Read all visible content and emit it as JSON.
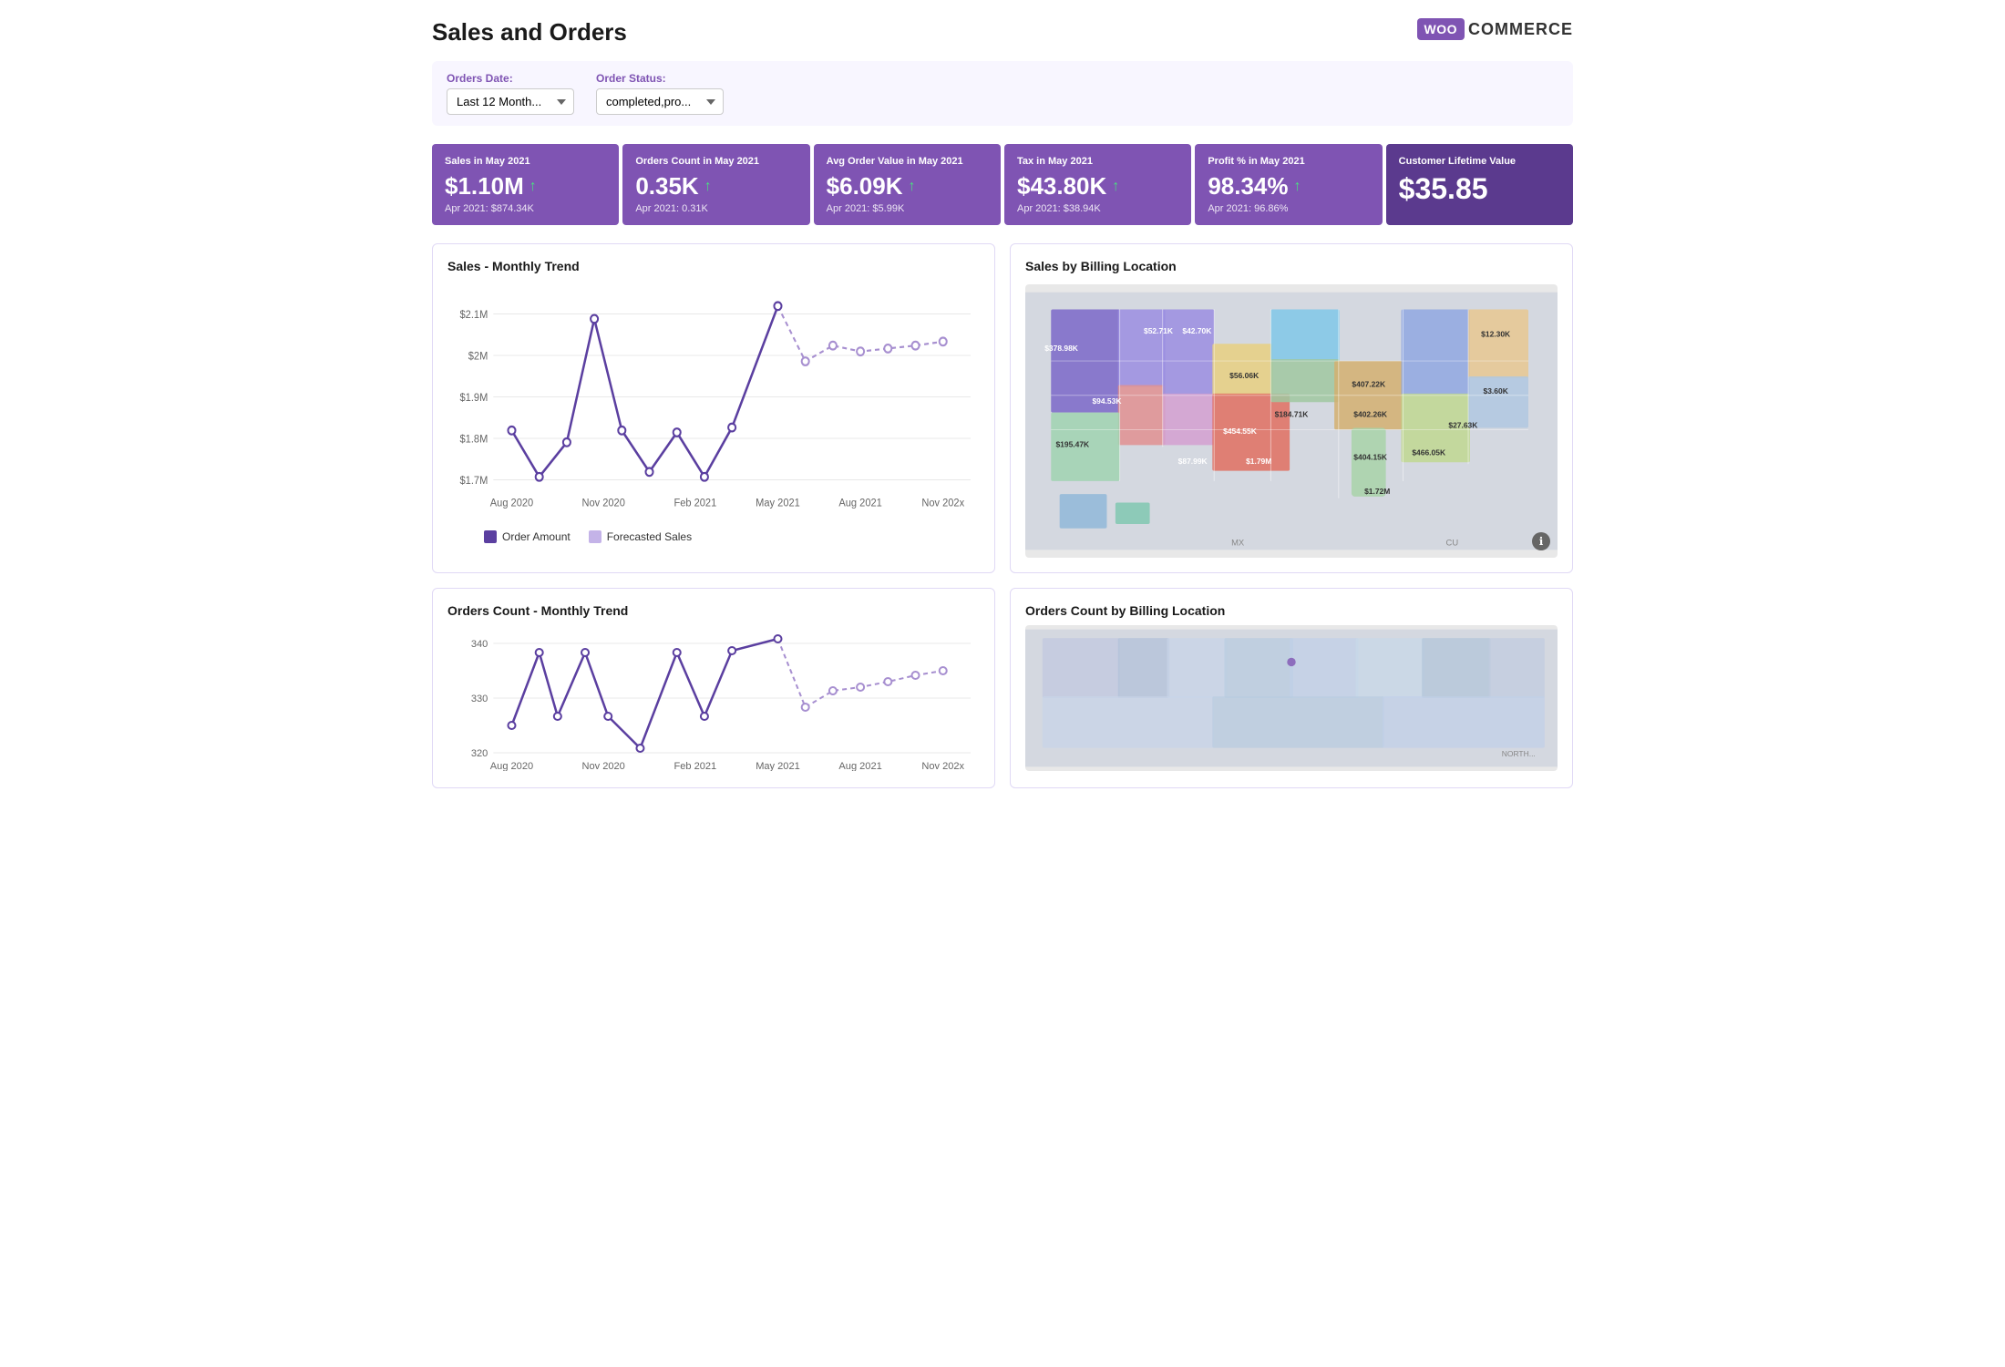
{
  "header": {
    "title": "Sales and Orders",
    "logo_woo": "WOO",
    "logo_commerce": "COMMERCE"
  },
  "filters": {
    "date_label": "Orders Date:",
    "date_value": "Last 12 Month...",
    "status_label": "Order Status:",
    "status_value": "completed,pro..."
  },
  "kpi_cards": [
    {
      "title": "Sales in May 2021",
      "value": "$1.10M",
      "arrow": "↑",
      "prev": "Apr 2021: $874.34K"
    },
    {
      "title": "Orders Count in May 2021",
      "value": "0.35K",
      "arrow": "↑",
      "prev": "Apr 2021: 0.31K"
    },
    {
      "title": "Avg Order Value in May 2021",
      "value": "$6.09K",
      "arrow": "↑",
      "prev": "Apr 2021: $5.99K"
    },
    {
      "title": "Tax in May 2021",
      "value": "$43.80K",
      "arrow": "↑",
      "prev": "Apr 2021: $38.94K"
    },
    {
      "title": "Profit % in May 2021",
      "value": "98.34%",
      "arrow": "↑",
      "prev": "Apr 2021: 96.86%"
    },
    {
      "title": "Customer Lifetime Value",
      "value": "$35.85",
      "arrow": "",
      "prev": ""
    }
  ],
  "sales_trend_chart": {
    "title": "Sales - Monthly Trend",
    "y_labels": [
      "$2.1M",
      "$2M",
      "$1.9M",
      "$1.8M",
      "$1.7M"
    ],
    "x_labels": [
      "Aug 2020",
      "Nov 2020",
      "Feb 2021",
      "May 2021",
      "Aug 2021",
      "Nov 202x"
    ],
    "legend": {
      "order_amount": "Order Amount",
      "forecasted_sales": "Forecasted Sales"
    }
  },
  "billing_location_chart": {
    "title": "Sales by Billing Location",
    "map_labels": [
      {
        "text": "$378.98K",
        "left": "21%",
        "top": "30%"
      },
      {
        "text": "$52.71K",
        "left": "33%",
        "top": "28%"
      },
      {
        "text": "$42.70K",
        "left": "43%",
        "top": "25%"
      },
      {
        "text": "$94.53K",
        "left": "25%",
        "top": "38%"
      },
      {
        "text": "$56.06K",
        "left": "42%",
        "top": "35%"
      },
      {
        "text": "$407.22K",
        "left": "57%",
        "top": "33%"
      },
      {
        "text": "$12.30K",
        "left": "78%",
        "top": "28%"
      },
      {
        "text": "$184.71K",
        "left": "46%",
        "top": "43%"
      },
      {
        "text": "$195.47K",
        "left": "16%",
        "top": "52%"
      },
      {
        "text": "$454.55K",
        "left": "35%",
        "top": "54%"
      },
      {
        "text": "$402.26K",
        "left": "55%",
        "top": "48%"
      },
      {
        "text": "$3.60K",
        "left": "82%",
        "top": "38%"
      },
      {
        "text": "$27.63K",
        "left": "73%",
        "top": "46%"
      },
      {
        "text": "$87.99K",
        "left": "30%",
        "top": "64%"
      },
      {
        "text": "$1.79M",
        "left": "42%",
        "top": "68%"
      },
      {
        "text": "$404.15K",
        "left": "55%",
        "top": "62%"
      },
      {
        "text": "$466.05K",
        "left": "68%",
        "top": "58%"
      },
      {
        "text": "$1.72M",
        "left": "60%",
        "top": "75%"
      }
    ]
  },
  "orders_count_chart": {
    "title": "Orders Count - Monthly Trend",
    "y_labels": [
      "340",
      "320"
    ],
    "x_labels": [
      "Aug 2020",
      "Nov 2020",
      "Feb 2021",
      "May 2021",
      "Aug 2021",
      "Nov 202x"
    ]
  },
  "orders_billing_chart": {
    "title": "Orders Count by Billing Location"
  }
}
